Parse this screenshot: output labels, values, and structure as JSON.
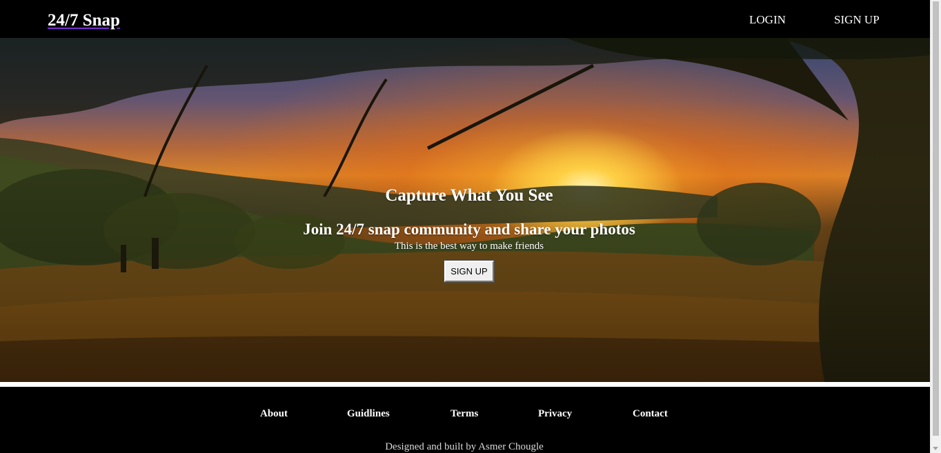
{
  "header": {
    "brand": "24/7 Snap",
    "nav": {
      "login": "LOGIN",
      "signup": "SIGN UP"
    }
  },
  "hero": {
    "title": "Capture What You See",
    "subtitle": "Join 24/7 snap community and share your photos",
    "tagline": "This is the best way to make friends",
    "button": "SIGN UP"
  },
  "footer": {
    "links": {
      "about": "About",
      "guidelines": "Guidlines",
      "terms": "Terms",
      "privacy": "Privacy",
      "contact": "Contact"
    },
    "credit": "Designed and built by Asmer Chougle"
  },
  "colors": {
    "header_bg": "#000000",
    "footer_bg": "#000000",
    "brand_underline": "#7b2fd6",
    "text": "#ffffff"
  }
}
